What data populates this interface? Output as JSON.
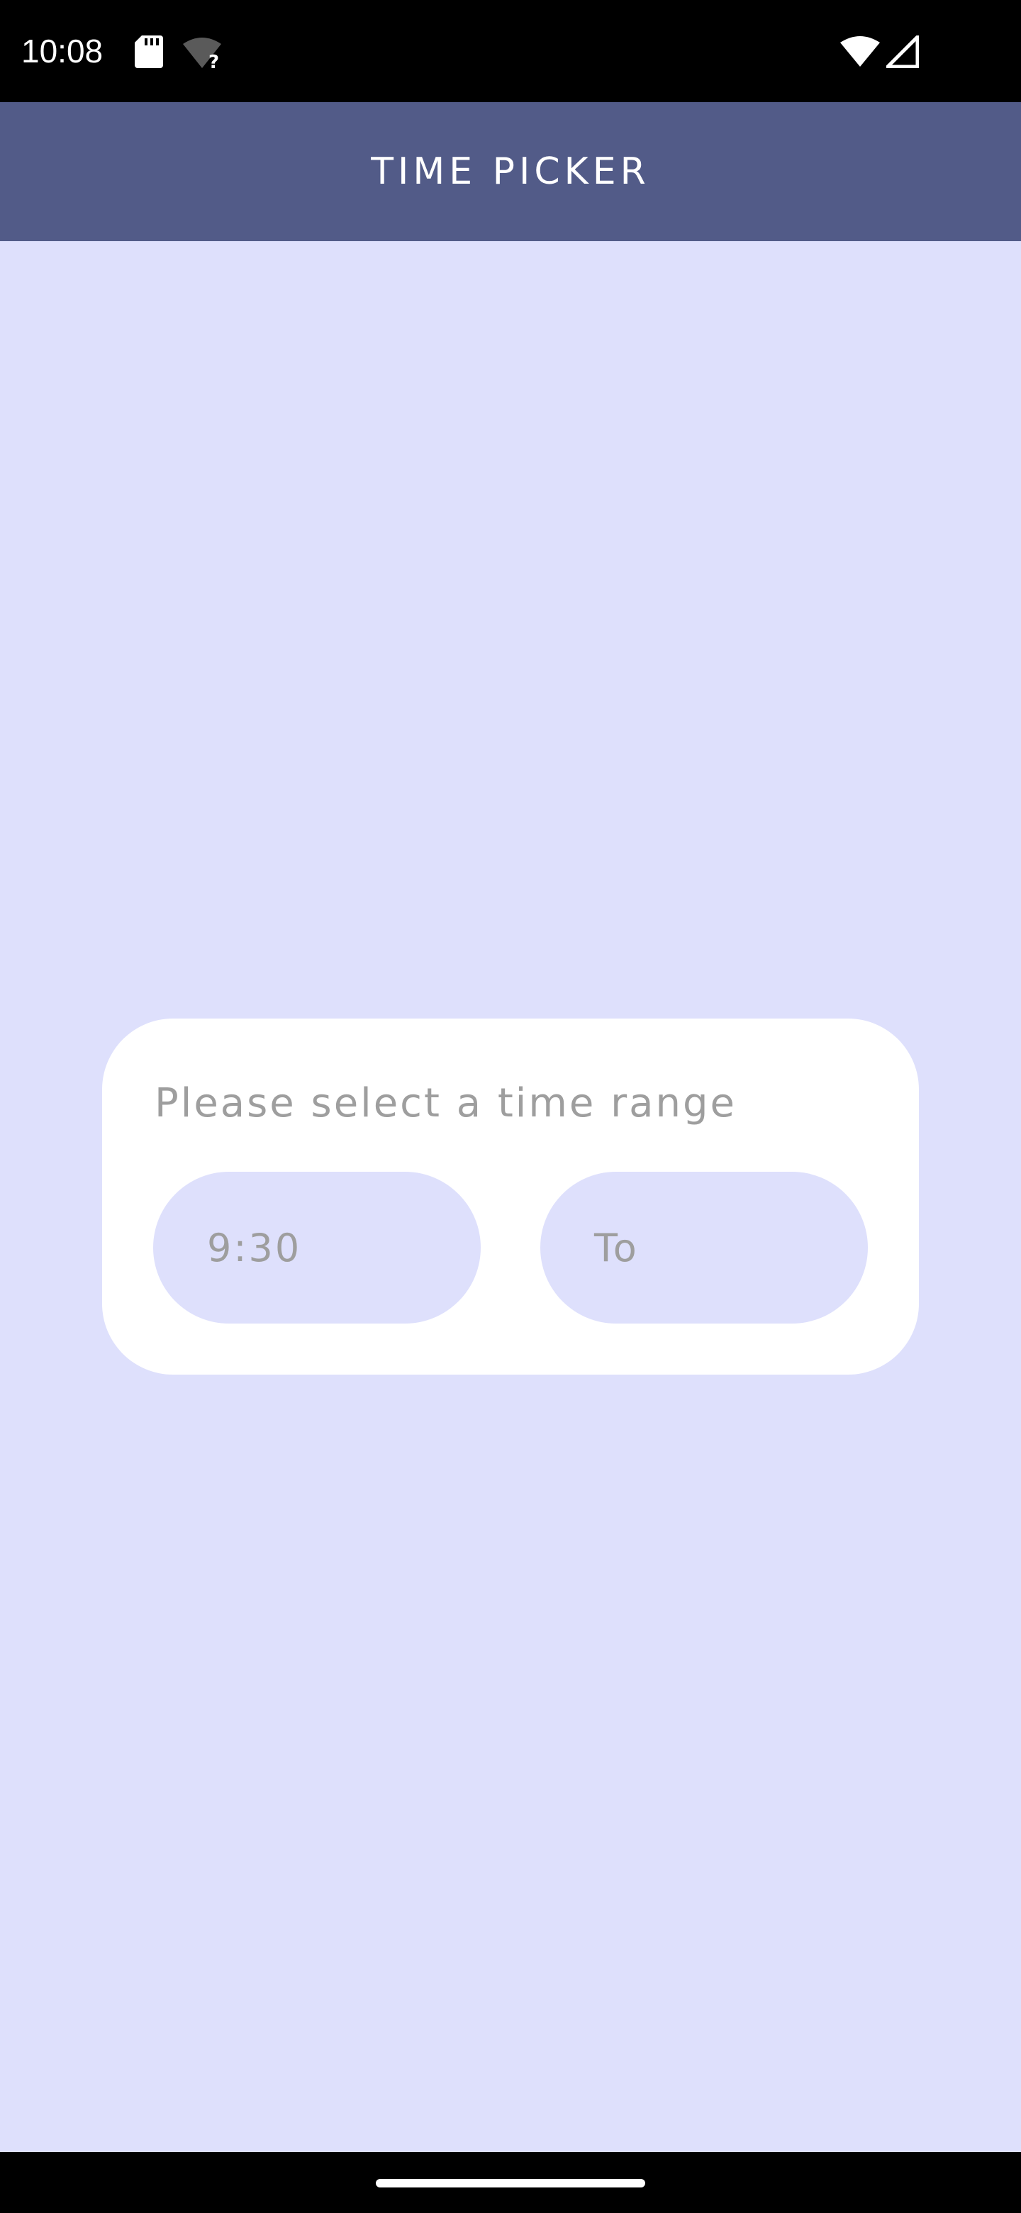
{
  "status_bar": {
    "time": "10:08",
    "icons": [
      "sd-card-icon",
      "wifi-unknown-icon",
      "wifi-icon",
      "cell-signal-icon"
    ]
  },
  "app_bar": {
    "title": "TIME PICKER",
    "color": "#525B88"
  },
  "card": {
    "prompt": "Please select a time range",
    "from_value": "9:30",
    "to_placeholder": "To"
  },
  "colors": {
    "background": "#DEE0FC",
    "card": "#FFFFFF",
    "pill": "#DEE0FC",
    "hint_text": "#9E9E9E"
  }
}
